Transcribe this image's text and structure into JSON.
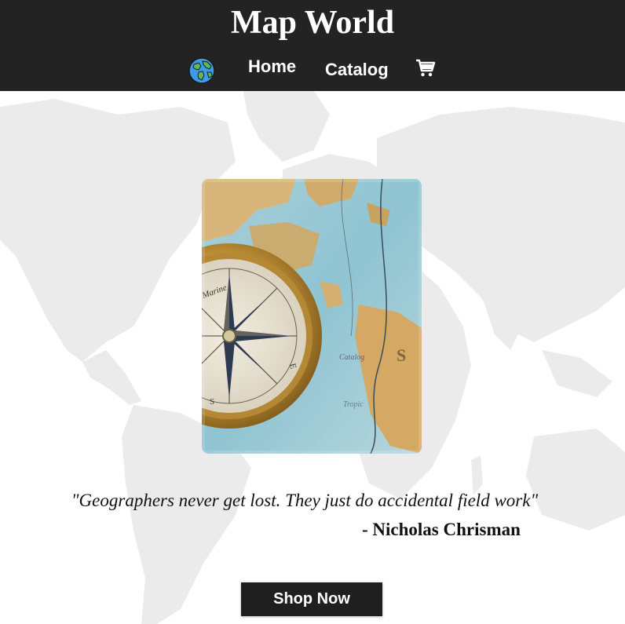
{
  "header": {
    "title": "Map World",
    "nav": {
      "globe_icon": "globe-icon",
      "home_label": "Home",
      "catalog_label": "Catalog",
      "cart_icon": "cart-icon"
    }
  },
  "hero": {
    "image": "compass-on-map-photo"
  },
  "quote": {
    "text": "\"Geographers never get lost. They just do accidental field work\"",
    "author": "- Nicholas Chrisman"
  },
  "cta": {
    "label": "Shop Now"
  },
  "colors": {
    "header_bg": "#232323",
    "button_bg": "#1f1f1f",
    "map_land": "#ececec",
    "page_bg": "#ffffff"
  }
}
